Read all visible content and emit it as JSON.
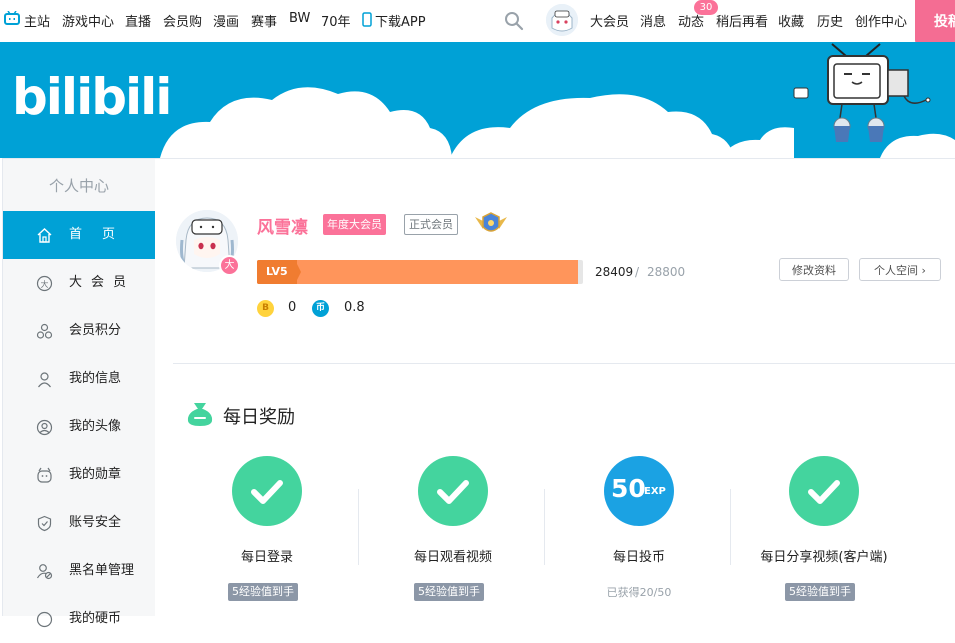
{
  "topnav": {
    "items": [
      "主站",
      "游戏中心",
      "直播",
      "会员购",
      "漫画",
      "赛事",
      "BW",
      "70年",
      "下载APP"
    ],
    "right_items": [
      "大会员",
      "消息",
      "动态",
      "稍后再看",
      "收藏",
      "历史",
      "创作中心"
    ],
    "dynamic_badge": "30",
    "upload_label": "投稿"
  },
  "banner": {
    "logo_text": "bilibili"
  },
  "sidebar": {
    "title": "个人中心",
    "items": [
      {
        "label": "首页",
        "icon": "home-icon",
        "active": true
      },
      {
        "label": "大会员",
        "icon": "vip-icon",
        "active": false
      },
      {
        "label": "会员积分",
        "icon": "points-icon",
        "active": false
      },
      {
        "label": "我的信息",
        "icon": "user-icon",
        "active": false
      },
      {
        "label": "我的头像",
        "icon": "avatar-icon",
        "active": false
      },
      {
        "label": "我的勋章",
        "icon": "medal-icon",
        "active": false
      },
      {
        "label": "账号安全",
        "icon": "shield-icon",
        "active": false
      },
      {
        "label": "黑名单管理",
        "icon": "blacklist-icon",
        "active": false
      },
      {
        "label": "我的硬币",
        "icon": "coin-icon",
        "active": false
      }
    ]
  },
  "profile": {
    "username": "风雪凛",
    "vip_tag": "年度大会员",
    "member_tag": "正式会员",
    "vip_badge": "大",
    "level": "LV5",
    "exp_current": "28409",
    "exp_separator": "/",
    "exp_max": "28800",
    "exp_progress": 0.986,
    "edit_button": "修改资料",
    "space_button": "个人空间",
    "bcoin_symbol": "B",
    "bcoin": "0",
    "coin_symbol": "币",
    "coins": "0.8"
  },
  "daily_reward": {
    "title": "每日奖励",
    "tasks": [
      {
        "name": "每日登录",
        "tag": "5经验值到手",
        "done": true
      },
      {
        "name": "每日观看视频",
        "tag": "5经验值到手",
        "done": true
      },
      {
        "name": "每日投币",
        "exp_value": "50",
        "exp_unit": "EXP",
        "note": "已获得20/50",
        "done": false
      },
      {
        "name": "每日分享视频(客户端)",
        "tag": "5经验值到手",
        "done": true
      }
    ]
  },
  "colors": {
    "brand_blue": "#00a1d6",
    "brand_pink": "#fb7299",
    "success_green": "#44d49e",
    "level_orange": "#ff955b"
  }
}
